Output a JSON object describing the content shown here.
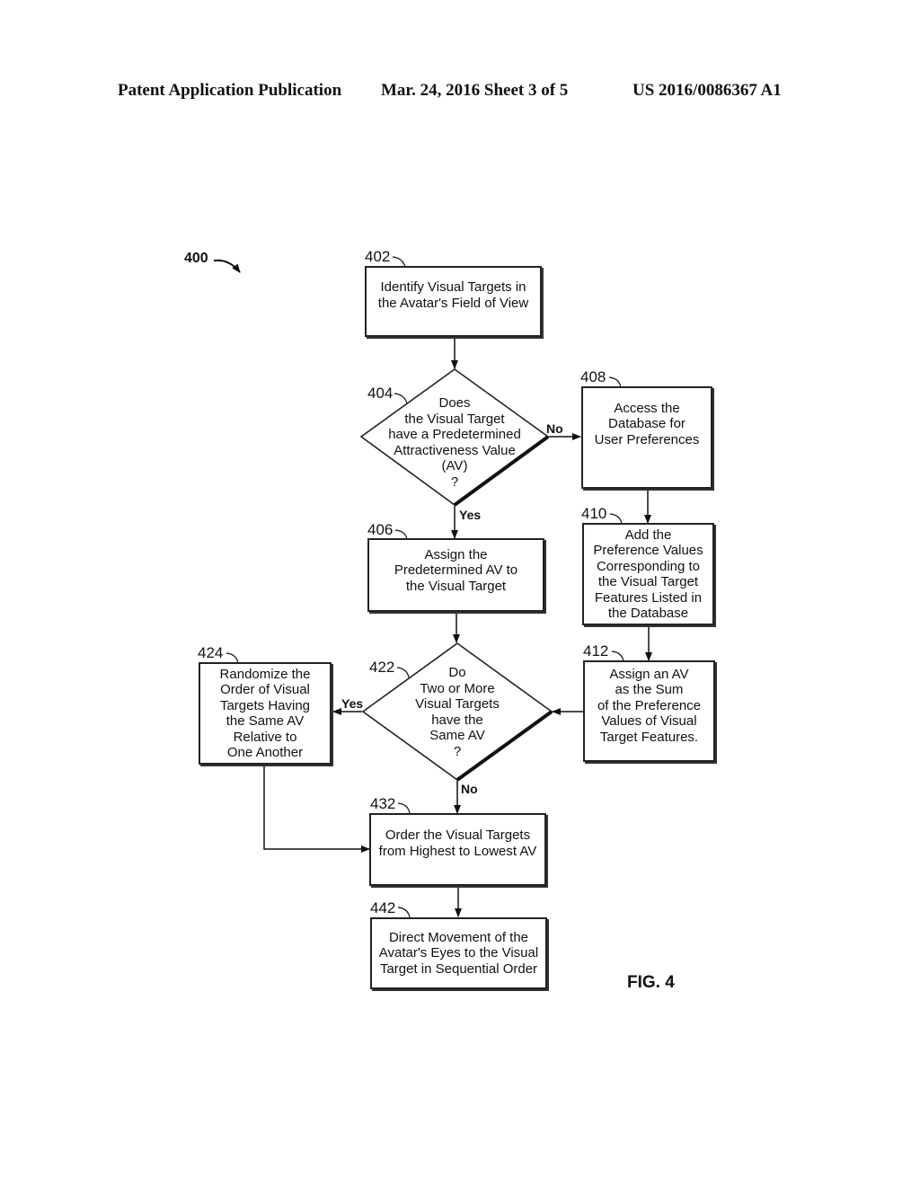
{
  "header": {
    "publication": "Patent Application Publication",
    "date_sheet": "Mar. 24, 2016  Sheet 3 of 5",
    "number": "US 2016/0086367 A1"
  },
  "figure": {
    "ref": "400",
    "label": "FIG. 4"
  },
  "nodes": {
    "n402": {
      "ref": "402",
      "text": "Identify Visual Targets in\nthe Avatar's Field of View"
    },
    "n404": {
      "ref": "404",
      "text": "Does\nthe Visual Target\nhave a Predetermined\nAttractiveness Value\n(AV)\n?"
    },
    "n406": {
      "ref": "406",
      "text": "Assign the\nPredetermined AV to\nthe Visual Target"
    },
    "n408": {
      "ref": "408",
      "text": "Access the\nDatabase for\nUser Preferences"
    },
    "n410": {
      "ref": "410",
      "text": "Add the\nPreference Values\nCorresponding to\nthe Visual Target\nFeatures Listed in\nthe Database"
    },
    "n412": {
      "ref": "412",
      "text": "Assign an AV\nas the Sum\nof the Preference\nValues of Visual\nTarget Features."
    },
    "n422": {
      "ref": "422",
      "text": "Do\nTwo or More\nVisual Targets\nhave the\nSame AV\n?"
    },
    "n424": {
      "ref": "424",
      "text": "Randomize the\nOrder of Visual\nTargets Having\nthe Same AV\nRelative to\nOne Another"
    },
    "n432": {
      "ref": "432",
      "text": "Order the Visual Targets\nfrom Highest to Lowest AV"
    },
    "n442": {
      "ref": "442",
      "text": "Direct Movement of the\nAvatar's Eyes to the Visual\nTarget in Sequential Order"
    }
  },
  "edge_labels": {
    "no_404": "No",
    "yes_404": "Yes",
    "yes_422": "Yes",
    "no_422": "No"
  }
}
